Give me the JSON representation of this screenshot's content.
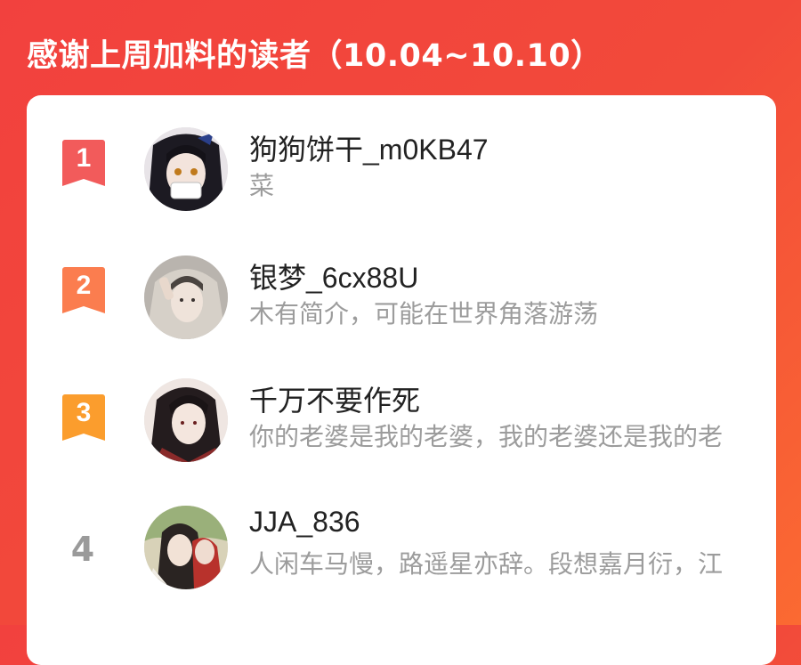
{
  "header": {
    "title": "感谢上周加料的读者（10.04~10.10）"
  },
  "readers": [
    {
      "rank": "1",
      "name": "狗狗饼干_m0KB47",
      "bio": "菜",
      "badge_color": "#f25b5b"
    },
    {
      "rank": "2",
      "name": "银梦_6cx88U",
      "bio": "木有简介，可能在世界角落游荡",
      "badge_color": "#fb7d4f"
    },
    {
      "rank": "3",
      "name": "千万不要作死",
      "bio": "你的老婆是我的老婆，我的老婆还是我的老",
      "badge_color": "#fb9d2d"
    },
    {
      "rank": "4",
      "name": "JJA_836",
      "bio": "人闲车马慢，路遥星亦辞。段想嘉月衍，江"
    }
  ]
}
